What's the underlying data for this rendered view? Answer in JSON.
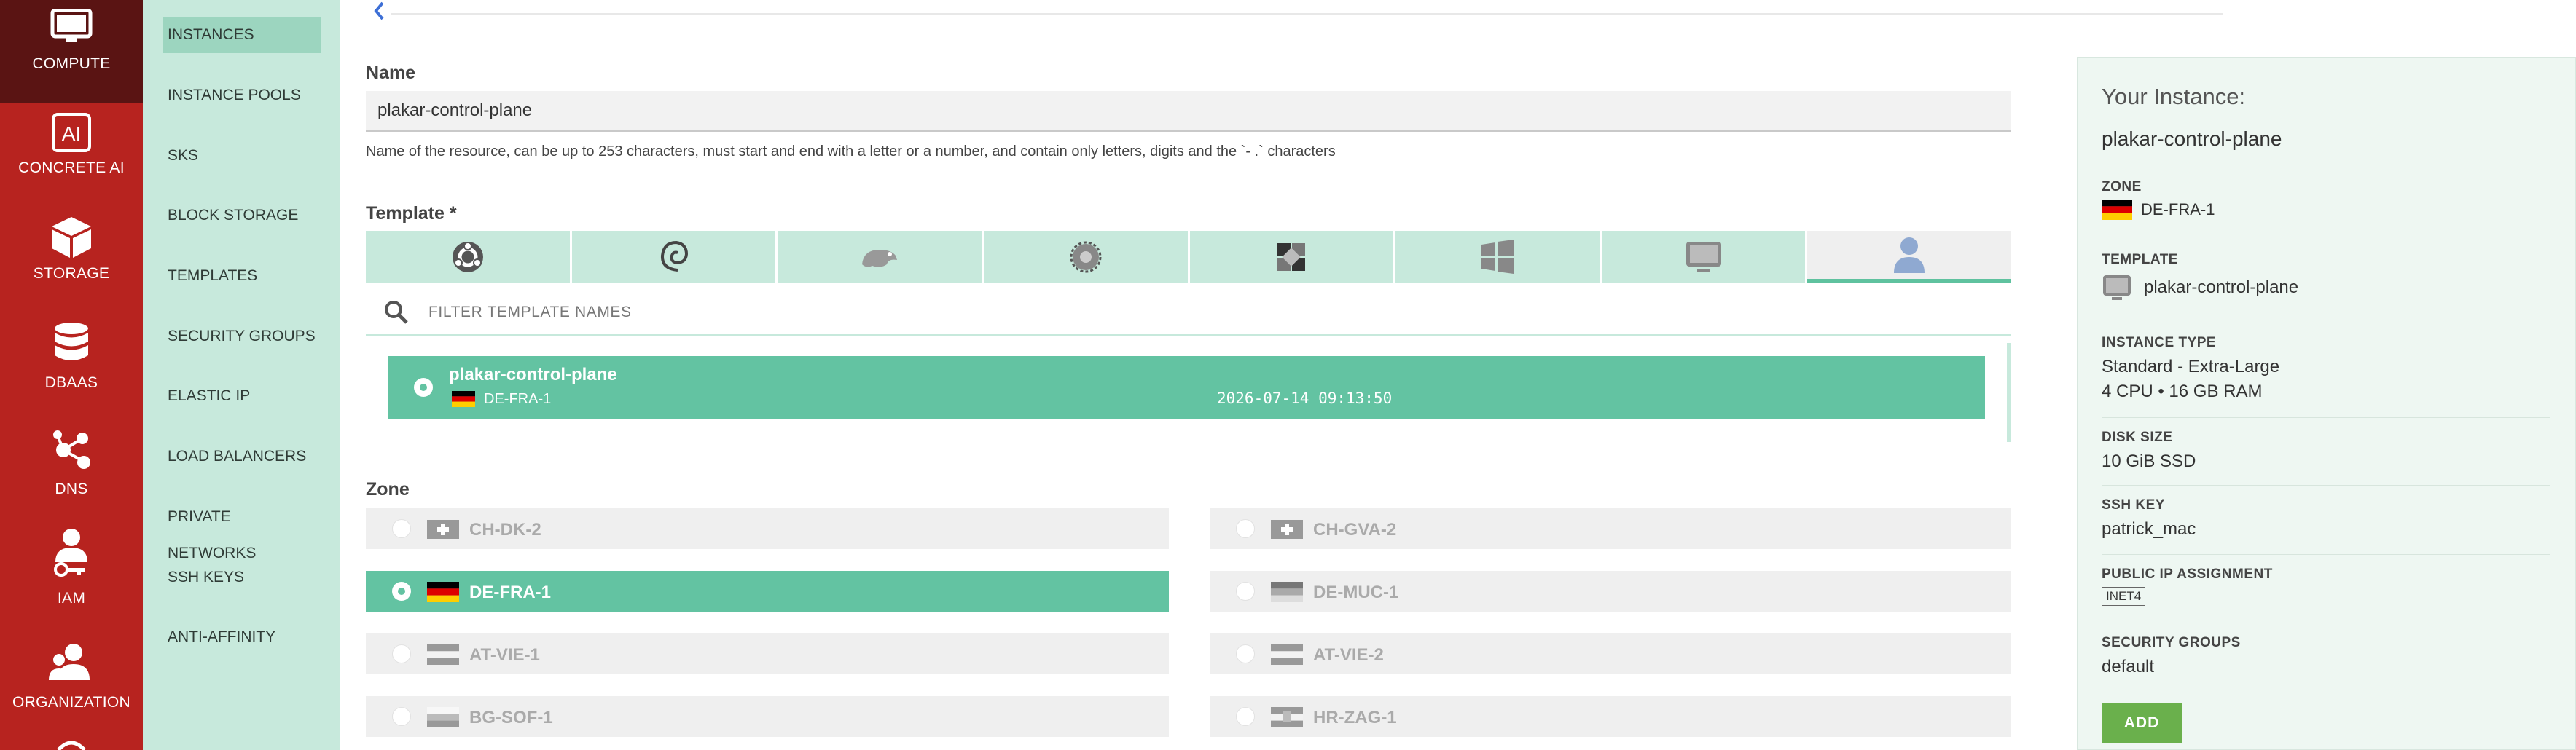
{
  "nav": {
    "items": [
      {
        "label": "COMPUTE",
        "icon": "monitor-icon"
      },
      {
        "label": "CONCRETE AI",
        "icon": "ai-icon"
      },
      {
        "label": "STORAGE",
        "icon": "cube-icon"
      },
      {
        "label": "DBAAS",
        "icon": "database-icon"
      },
      {
        "label": "DNS",
        "icon": "network-icon"
      },
      {
        "label": "IAM",
        "icon": "user-key-icon"
      },
      {
        "label": "ORGANIZATION",
        "icon": "users-icon"
      }
    ]
  },
  "subnav": {
    "items": [
      "INSTANCES",
      "INSTANCE POOLS",
      "SKS",
      "BLOCK STORAGE",
      "TEMPLATES",
      "SECURITY GROUPS",
      "ELASTIC IP",
      "LOAD BALANCERS",
      "PRIVATE NETWORKS",
      "SSH KEYS",
      "ANTI-AFFINITY"
    ]
  },
  "form": {
    "name_label": "Name",
    "name_value": "plakar-control-plane",
    "name_help": "Name of the resource, can be up to 253 characters, must start and end with a letter or a number, and contain only letters, digits and the `- .` characters",
    "template_label": "Template *",
    "template_tabs": [
      "ubuntu-icon",
      "debian-icon",
      "opensuse-icon",
      "centos-icon",
      "linux-icon",
      "windows-icon",
      "monitor-icon",
      "user-icon"
    ],
    "filter_placeholder": "FILTER TEMPLATE NAMES",
    "template_item": {
      "name": "plakar-control-plane",
      "zone": "DE-FRA-1",
      "date": "2026-07-14 09:13:50"
    },
    "zone_label": "Zone",
    "zones": [
      {
        "name": "CH-DK-2",
        "flag": "swiss"
      },
      {
        "name": "CH-GVA-2",
        "flag": "swiss"
      },
      {
        "name": "DE-FRA-1",
        "flag": "germany"
      },
      {
        "name": "DE-MUC-1",
        "flag": "germany-grey"
      },
      {
        "name": "AT-VIE-1",
        "flag": "austria-grey"
      },
      {
        "name": "AT-VIE-2",
        "flag": "austria-grey"
      },
      {
        "name": "BG-SOF-1",
        "flag": "bulgaria-grey"
      },
      {
        "name": "HR-ZAG-1",
        "flag": "croatia-grey"
      }
    ]
  },
  "summary": {
    "title": "Your Instance:",
    "name": "plakar-control-plane",
    "zone_h": "ZONE",
    "zone_v": "DE-FRA-1",
    "template_h": "TEMPLATE",
    "template_v": "plakar-control-plane",
    "type_h": "INSTANCE TYPE",
    "type_v1": "Standard - Extra-Large",
    "type_v2": "4 CPU • 16 GB RAM",
    "disk_h": "DISK SIZE",
    "disk_v": "10 GiB SSD",
    "ssh_h": "SSH KEY",
    "ssh_v": "patrick_mac",
    "ip_h": "PUBLIC IP ASSIGNMENT",
    "ip_v": "INET4",
    "sg_h": "SECURITY GROUPS",
    "sg_v": "default",
    "add_label": "ADD"
  },
  "colors": {
    "nav_red": "#b7231f",
    "nav_active": "#5a1413",
    "mint": "#c7e9dc",
    "green": "#63c3a2",
    "add_green": "#6ab04c"
  }
}
